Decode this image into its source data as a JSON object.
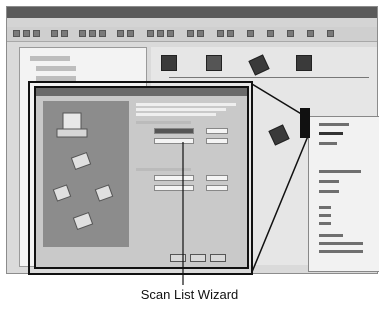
{
  "caption": "Scan List Wizard",
  "colors": {
    "frame": "#111111",
    "window_bg": "#dadada",
    "titlebar": "#5a5a5a",
    "wizard_panel": "#8c8c8c"
  },
  "icons": {
    "computer": "computer-icon",
    "device": "network-device-icon"
  }
}
